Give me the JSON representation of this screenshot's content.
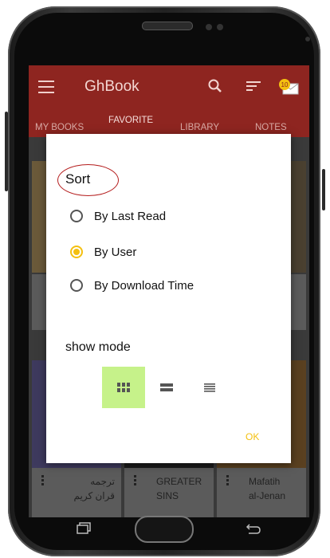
{
  "app": {
    "title": "GhBook",
    "tabs": [
      "MY BOOKS",
      "FAVORITE",
      "LIBRARY",
      "NOTES"
    ],
    "notification_count": "10"
  },
  "books": [
    {
      "title_line1": "ترجمه",
      "title_line2": "قران کریم"
    },
    {
      "title_line1": "GREATER",
      "title_line2": "SINS"
    },
    {
      "title_line1": "Mafatih",
      "title_line2": "al-Jenan"
    }
  ],
  "dialog": {
    "title": "Sort",
    "options": [
      "By Last Read",
      "By User",
      "By Download Time"
    ],
    "selected_option": "By User",
    "show_mode_label": "show mode",
    "view_modes": [
      "grid-icon",
      "large-list-icon",
      "list-icon"
    ],
    "selected_view_mode": "grid-icon",
    "ok_label": "OK"
  },
  "colors": {
    "appbar": "#8e2520",
    "accent": "#f4c010",
    "selected_mode_bg": "#c6f28a",
    "annotation_circle": "#b41c1c"
  }
}
